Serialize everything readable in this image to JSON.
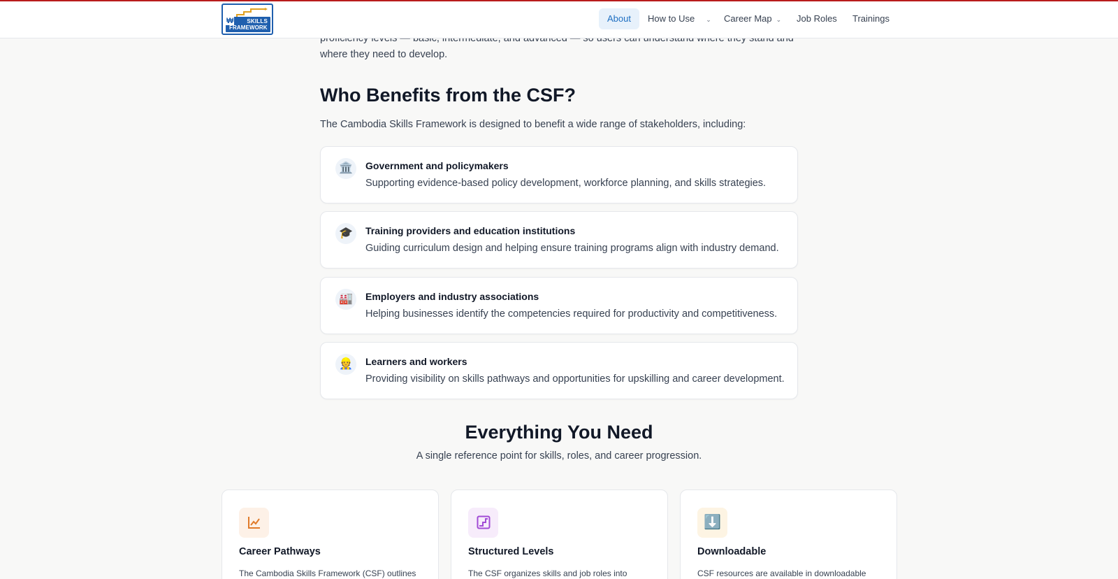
{
  "brand": {
    "logo_line1": "SKILLS",
    "logo_line2": "FRAMEWORK",
    "logo_glyph": "₩",
    "accent": "#1e6fc2",
    "top_border": "#b91c1c"
  },
  "nav": {
    "items": [
      {
        "label": "About",
        "active": true
      },
      {
        "label": "How to Use",
        "dropdown": true
      },
      {
        "label": "Career Map",
        "dropdown": true
      },
      {
        "label": "Job Roles"
      },
      {
        "label": "Trainings"
      }
    ],
    "chevron_icon": "chevron-down-icon",
    "chevron_glyph": "⌄"
  },
  "intro": {
    "text": "proficiency levels — basic, intermediate, and advanced — so users can understand where they stand and where they need to develop."
  },
  "benefits": {
    "title": "Who Benefits from the CSF?",
    "lead": "The Cambodia Skills Framework is designed to benefit a wide range of stakeholders, including:",
    "items": [
      {
        "icon": "🏛️",
        "icon_name": "government-building-icon",
        "title": "Government and policymakers",
        "desc": "Supporting evidence-based policy development, workforce planning, and skills strategies."
      },
      {
        "icon": "🎓",
        "icon_name": "graduation-cap-icon",
        "title": "Training providers and education institutions",
        "desc": "Guiding curriculum design and helping ensure training programs align with industry demand."
      },
      {
        "icon": "🏭",
        "icon_name": "factory-icon",
        "title": "Employers and industry associations",
        "desc": "Helping businesses identify the competencies required for productivity and competitiveness."
      },
      {
        "icon": "👷",
        "icon_name": "worker-icon",
        "title": "Learners and workers",
        "desc": "Providing visibility on skills pathways and opportunities for upskilling and career development."
      }
    ]
  },
  "everything": {
    "title": "Everything You Need",
    "subtitle": "A single reference point for skills, roles, and career progression.",
    "features": [
      {
        "icon_name": "chart-line-icon",
        "icon_bg": "#fdf1e7",
        "icon_color": "#e07b2a",
        "title": "Career Pathways",
        "desc": "The Cambodia Skills Framework (CSF) outlines"
      },
      {
        "icon_name": "stairs-icon",
        "icon_bg": "#f7ecfb",
        "icon_color": "#a24bd6",
        "title": "Structured Levels",
        "desc": "The CSF organizes skills and job roles into"
      },
      {
        "icon": "⬇️",
        "icon_name": "download-icon",
        "icon_bg": "#fdf4e3",
        "title": "Downloadable",
        "desc": "CSF resources are available in downloadable"
      }
    ]
  }
}
